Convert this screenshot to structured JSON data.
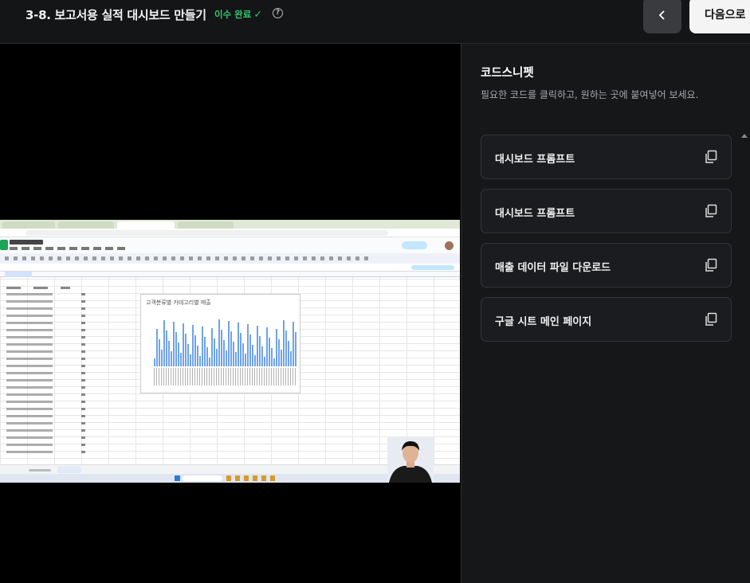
{
  "header": {
    "lesson_title": "3-8. 보고서용 실적 대시보드 만들기",
    "status_label": "이수 완료",
    "status_color": "#2fc56b",
    "next_label": "다음으로"
  },
  "video": {
    "chart_title": "고객분류별 카테고리별 매출"
  },
  "panel": {
    "title": "코드스니펫",
    "description": "필요한 코드를 클릭하고, 원하는 곳에 붙여넣어 보세요.",
    "snippets": [
      {
        "label": "대시보드 프롬프트"
      },
      {
        "label": "대시보드 프롬프트"
      },
      {
        "label": "매출 데이터 파일 다운로드"
      },
      {
        "label": "구글 시트 메인 페이지"
      }
    ]
  }
}
